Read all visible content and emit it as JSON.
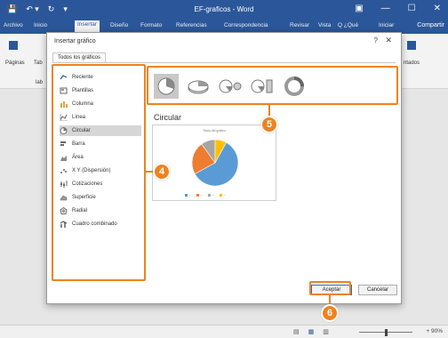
{
  "window": {
    "title": "EF-graficos - Word",
    "qat": [
      "💾",
      "↶ ▾",
      "↻",
      "▾"
    ],
    "controls": [
      "▣",
      "—",
      "☐",
      "✕"
    ]
  },
  "ribbon_tabs": [
    {
      "label": "Archivo",
      "active": false
    },
    {
      "label": "Inicio",
      "active": false
    },
    {
      "label": "Insertar",
      "active": true
    },
    {
      "label": "Diseño",
      "active": false
    },
    {
      "label": "Formato",
      "active": false
    },
    {
      "label": "Referencias",
      "active": false
    },
    {
      "label": "Correspondencia",
      "active": false
    },
    {
      "label": "Revisar",
      "active": false
    },
    {
      "label": "Vista",
      "active": false
    },
    {
      "label": "Q ¿Qué",
      "active": false
    },
    {
      "label": "Iniciar",
      "active": false
    }
  ],
  "share_label": "Compartir",
  "ribbon": {
    "left_label": "Páginas",
    "left_label2": "Tab",
    "left_label3": "lab",
    "right_label": "ntados"
  },
  "dialog": {
    "title": "Insertar gráfico",
    "help": "?",
    "close": "✕",
    "tab": "Todos los gráficos",
    "chart_types": [
      {
        "label": "Reciente",
        "icon": "recent-icon",
        "selected": false
      },
      {
        "label": "Plantillas",
        "icon": "templates-icon",
        "selected": false
      },
      {
        "label": "Columna",
        "icon": "column-chart-icon",
        "selected": false
      },
      {
        "label": "Línea",
        "icon": "line-chart-icon",
        "selected": false
      },
      {
        "label": "Circular",
        "icon": "pie-chart-icon",
        "selected": true
      },
      {
        "label": "Barra",
        "icon": "bar-chart-icon",
        "selected": false
      },
      {
        "label": "Área",
        "icon": "area-chart-icon",
        "selected": false
      },
      {
        "label": "X Y (Dispersión)",
        "icon": "scatter-chart-icon",
        "selected": false
      },
      {
        "label": "Cotizaciones",
        "icon": "stock-chart-icon",
        "selected": false
      },
      {
        "label": "Superficie",
        "icon": "surface-chart-icon",
        "selected": false
      },
      {
        "label": "Radial",
        "icon": "radar-chart-icon",
        "selected": false
      },
      {
        "label": "Cuadro combinado",
        "icon": "combo-chart-icon",
        "selected": false
      }
    ],
    "subtypes": [
      {
        "name": "pie-subtype-icon",
        "selected": true
      },
      {
        "name": "pie-3d-subtype-icon",
        "selected": false
      },
      {
        "name": "pie-of-pie-subtype-icon",
        "selected": false
      },
      {
        "name": "bar-of-pie-subtype-icon",
        "selected": false
      },
      {
        "name": "doughnut-subtype-icon",
        "selected": false
      }
    ],
    "preview_heading": "Circular",
    "preview_chart_title": "Título del gráfico",
    "ok_label": "Aceptar",
    "cancel_label": "Cancelar"
  },
  "callouts": {
    "c4": "4",
    "c5": "5",
    "c6": "6"
  },
  "statusbar": {
    "zoom": "+ 90%"
  },
  "colors": {
    "word_blue": "#2b579a",
    "highlight_orange": "#f0821e",
    "pie_blue": "#5b9bd5",
    "pie_orange": "#ed7d31",
    "pie_gray": "#a5a5a5",
    "pie_yellow": "#ffc000"
  },
  "chart_data": {
    "type": "pie",
    "title": "Título del gráfico",
    "slices": [
      {
        "color": "#5b9bd5",
        "value": 59
      },
      {
        "color": "#ed7d31",
        "value": 23
      },
      {
        "color": "#a5a5a5",
        "value": 10
      },
      {
        "color": "#ffc000",
        "value": 8
      }
    ]
  }
}
